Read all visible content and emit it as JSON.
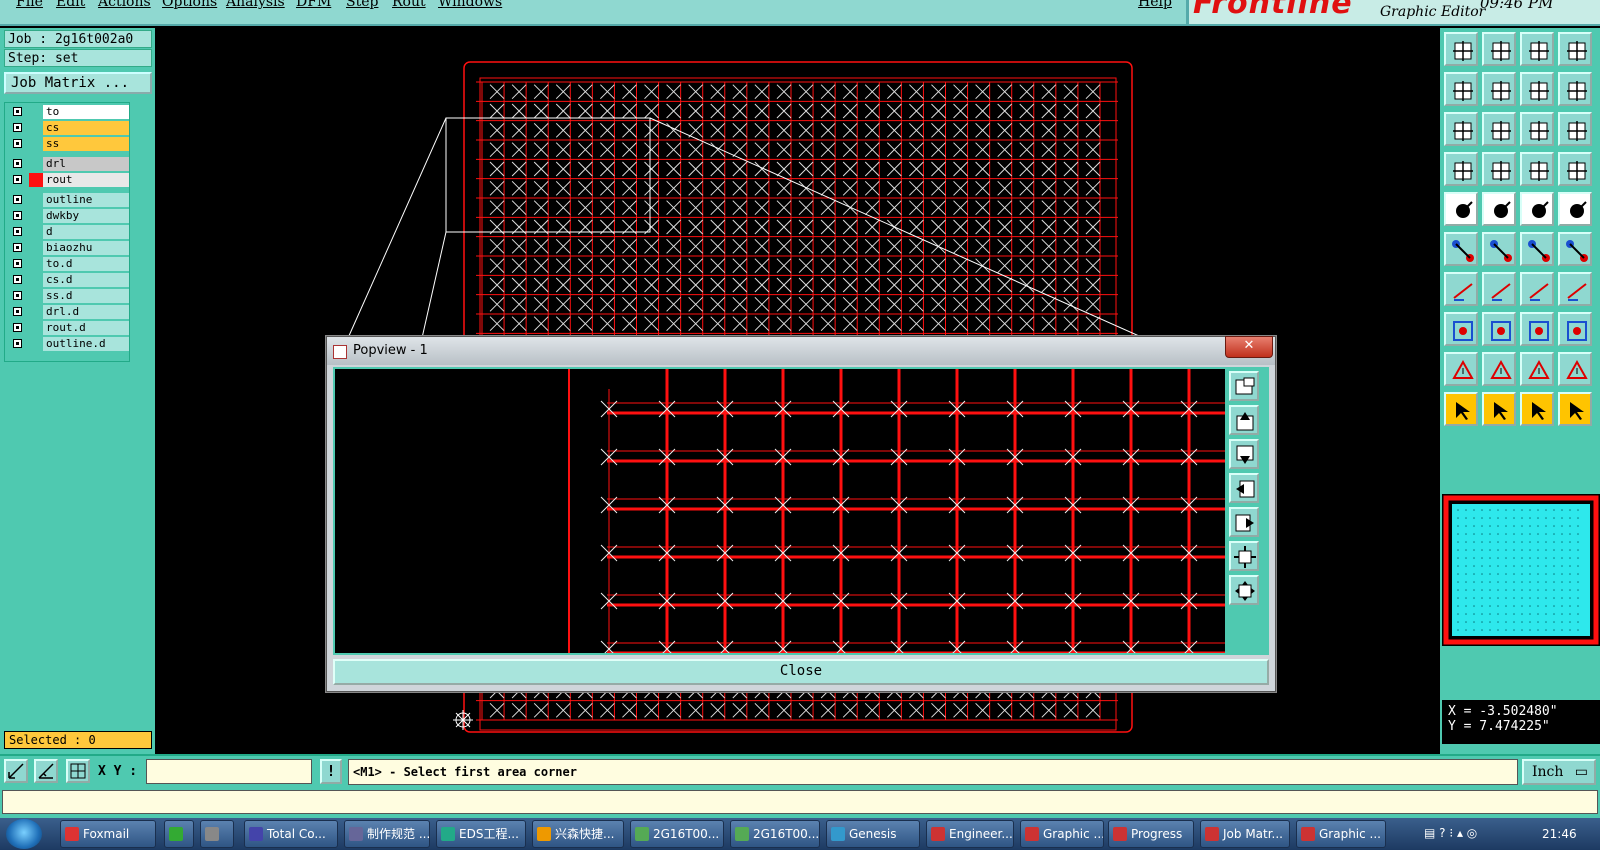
{
  "menu": [
    "File",
    "Edit",
    "Actions",
    "Options",
    "Analysis",
    "DFM",
    "Step",
    "Rout",
    "Windows",
    "Help"
  ],
  "brand": {
    "logo": "Frontline",
    "subtitle": "Graphic Editor",
    "time": "09:46 PM"
  },
  "job": {
    "job_line": "Job : 2g16t002a0",
    "step_line": "Step: set",
    "matrix_button": "Job Matrix ..."
  },
  "layers": [
    {
      "name": "to",
      "color": "#ffffff"
    },
    {
      "name": "cs",
      "color": "#ffc83c"
    },
    {
      "name": "ss",
      "color": "#ffc83c"
    },
    {
      "name": "drl",
      "color": "#c8c8c8"
    },
    {
      "name": "rout",
      "color": "#e8e8e8",
      "swatch": "#ff1010",
      "active": true
    },
    {
      "name": "outline",
      "color": "#a8e4dc"
    },
    {
      "name": "dwkby",
      "color": "#a8e4dc"
    },
    {
      "name": "d",
      "color": "#a8e4dc"
    },
    {
      "name": "biaozhu",
      "color": "#a8e4dc"
    },
    {
      "name": "to.d",
      "color": "#a8e4dc"
    },
    {
      "name": "cs.d",
      "color": "#a8e4dc"
    },
    {
      "name": "ss.d",
      "color": "#a8e4dc"
    },
    {
      "name": "drl.d",
      "color": "#a8e4dc"
    },
    {
      "name": "rout.d",
      "color": "#a8e4dc"
    },
    {
      "name": "outline.d",
      "color": "#a8e4dc"
    }
  ],
  "selected": "Selected : 0",
  "coords": {
    "x": "X = -3.502480\"",
    "y": "Y = 7.474225\""
  },
  "command": {
    "xy_label": "X Y :",
    "xy_value": "",
    "warn": "!",
    "prompt": "<M1> - Select first area corner",
    "unit": "Inch"
  },
  "popview": {
    "title": "Popview - 1",
    "close_x": "✕",
    "close_button": "Close"
  },
  "taskbar": {
    "items": [
      "Foxmail",
      "",
      "",
      "Total Co...",
      "制作规范 ...",
      "EDS工程...",
      "兴森快捷...",
      "2G16T00...",
      "2G16T00...",
      "Genesis",
      "Engineer...",
      "Graphic ...",
      "Progress",
      "Job Matr...",
      "Graphic ..."
    ],
    "clock": "21:46"
  },
  "colors": {
    "panel": "#4fc9b0",
    "light": "#a8e4dc",
    "rout": "#ff1010",
    "highlight": "#ffc83c"
  }
}
